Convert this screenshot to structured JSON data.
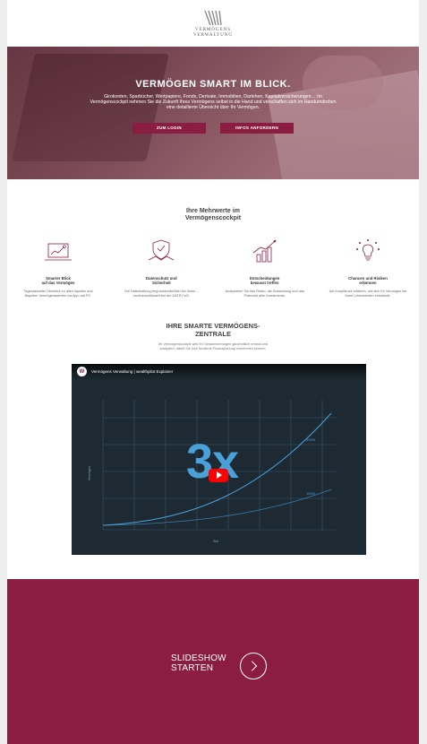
{
  "brand": {
    "line1": "VERMÖGENS",
    "line2": "VERWALTUNG",
    "accent": "#8b1d43"
  },
  "hero": {
    "title": "VERMÖGEN SMART IM BLICK.",
    "subtitle": "Girokonten, Sparbücher, Wertpapiere, Fonds, Derivate, Immobilien, Darlehen, Kapitalversicherungen… Im Vermögenscockpit nehmen Sie die Zukunft Ihres Vermögens selbst in die Hand und verschaffen sich im Handumdrehen eine detaillierte Übersicht über Ihr Vermögen.",
    "login_label": "ZUM LOGIN",
    "info_label": "INFOS ANFORDERN"
  },
  "benefits": {
    "title_line1": "Ihre Mehrwerte im",
    "title_line2": "Vermögenscockpit",
    "items": [
      {
        "icon": "laptop-chart-icon",
        "title_line1": "Smarter Blick",
        "title_line2": "auf das Vermögen",
        "text": "Tagesaktueller Überblick zu allen liquiden und illiquiden Vermögenswerten via App und PC."
      },
      {
        "icon": "handshake-shield-icon",
        "title_line1": "Datenschutz und",
        "title_line2": "Sicherheit",
        "text": "Die Datenhaltung liegt ausschließlich bei Ihnen – hochverschlüsselt bei der DATEV eG."
      },
      {
        "icon": "growth-chart-icon",
        "title_line1": "Entscheidungen",
        "title_line2": "bewusst treffen",
        "text": "Analysieren Sie das Risiko, die Entwicklung und das Potenzial aller Investments."
      },
      {
        "icon": "lightbulb-idea-icon",
        "title_line1": "Chancen und Risiken",
        "title_line2": "erkennen",
        "text": "Auf Knopfdruck erfahren, wie sich Ihr Vermögen bei Ihren Lebenszielen entwickelt."
      }
    ]
  },
  "smart": {
    "title_line1": "IHRE SMARTE VERMÖGENS-",
    "title_line2": "ZENTRALE",
    "text": "Ihr Vermögenscockpit wird Ihr Gesamtvermögen ganzheitlich erfasst und analysiert, damit Sie eine fundierte Finanzplanung vornehmen können."
  },
  "video": {
    "channel_initial": "W",
    "title": "Vermögens Verwaltung | wealthpilot Explainer",
    "big_text": "3x",
    "ylabel": "Vermögen",
    "xlabel": "Zeit",
    "tag_top": "300%",
    "tag_bottom": "100%"
  },
  "slideshow": {
    "line1": "SLIDESHOW",
    "line2": "STARTEN"
  }
}
